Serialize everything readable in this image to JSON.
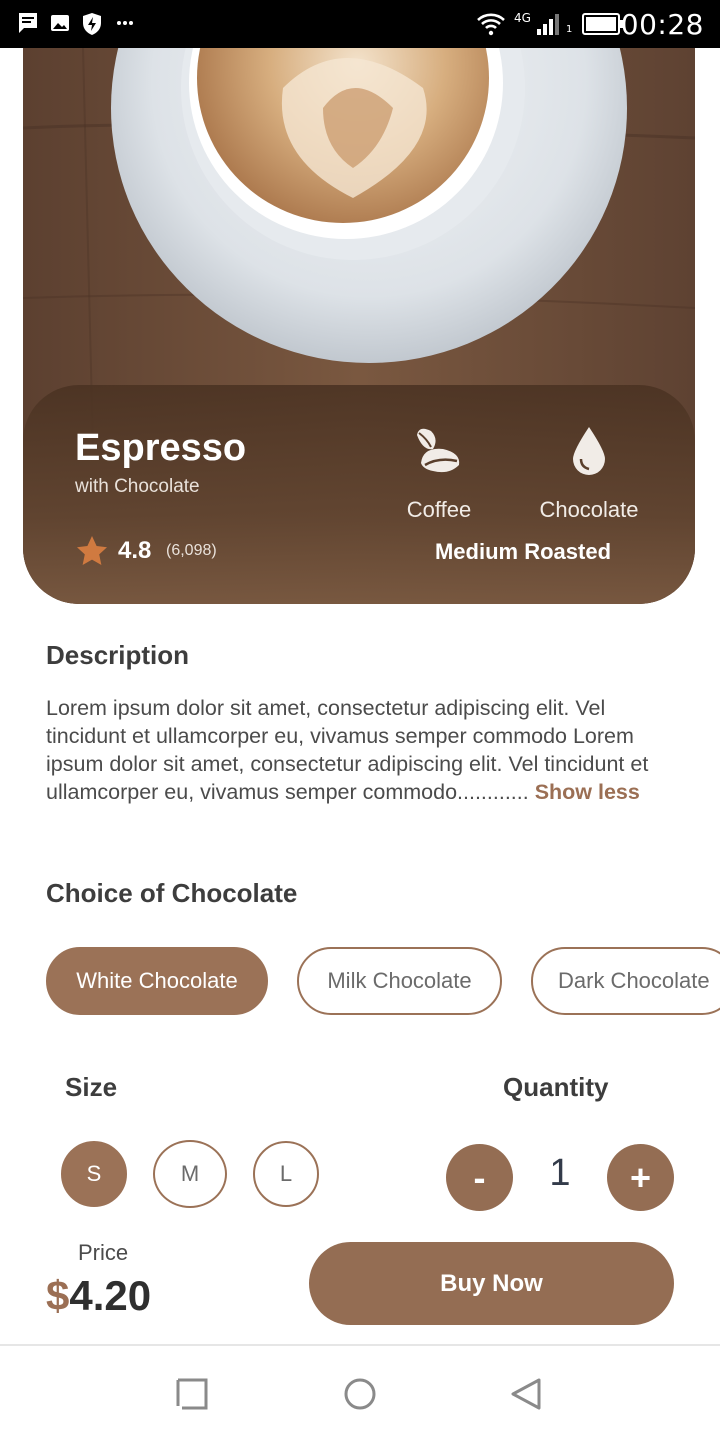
{
  "status_bar": {
    "time": "00:28",
    "network": "4G",
    "sim_slot": "1",
    "left_icons": [
      "message-icon",
      "image-icon",
      "shield-bolt-icon",
      "more-dots-icon"
    ],
    "right_icons": [
      "wifi-icon",
      "signal-icon",
      "battery-icon"
    ]
  },
  "product": {
    "name": "Espresso",
    "subtitle": "with Chocolate",
    "rating": "4.8",
    "rating_count": "(6,098)",
    "tags": [
      {
        "icon": "coffee-beans-icon",
        "label": "Coffee"
      },
      {
        "icon": "drop-icon",
        "label": "Chocolate"
      }
    ],
    "roast": "Medium Roasted"
  },
  "description": {
    "title": "Description",
    "text": "Lorem ipsum dolor sit amet, consectetur adipiscing elit. Vel tincidunt et ullamcorper eu, vivamus semper commodo Lorem ipsum dolor sit amet, consectetur adipiscing elit. Vel tincidunt et ullamcorper eu, vivamus semper commodo............ ",
    "toggle_label": "Show less"
  },
  "chocolate": {
    "title": "Choice of Chocolate",
    "options": [
      "White Chocolate",
      "Milk Chocolate",
      "Dark Chocolate"
    ],
    "selected": "White Chocolate"
  },
  "size": {
    "title": "Size",
    "options": [
      "S",
      "M",
      "L"
    ],
    "selected": "S"
  },
  "quantity": {
    "title": "Quantity",
    "decrement_label": "-",
    "value": "1",
    "increment_label": "+"
  },
  "purchase": {
    "price_label": "Price",
    "currency": "$",
    "price": "4.20",
    "buy_label": "Buy Now"
  },
  "colors": {
    "accent": "#9b7257",
    "button": "#946d53",
    "card": "#5a3f2c"
  },
  "nav_bar": {
    "icons": [
      "recent-apps-icon",
      "home-icon",
      "back-icon"
    ]
  }
}
